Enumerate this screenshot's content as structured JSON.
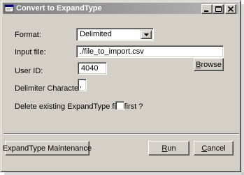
{
  "window": {
    "title": "Convert to ExpandType",
    "icon": "app-form-icon",
    "controls": [
      "minimize-icon",
      "maximize-icon",
      "close-icon"
    ]
  },
  "form": {
    "format_label": "Format:",
    "format_value": "Delimited",
    "input_file_label": "Input file:",
    "input_file_value": "./file_to_import.csv",
    "browse_button_first": "B",
    "browse_button_rest": "rowse",
    "user_id_label": "User ID:",
    "user_id_value": "4040",
    "delimiter_label": "Delimiter Character:",
    "delimiter_value": ",",
    "delete_existing_label": "Delete existing ExpandType file first ?",
    "delete_existing_checked": false
  },
  "footer": {
    "maintenance_button": "ExpandType Maintenance",
    "run_button_first": "R",
    "run_button_rest": "un",
    "cancel_button_first": "C",
    "cancel_button_rest": "ancel"
  }
}
